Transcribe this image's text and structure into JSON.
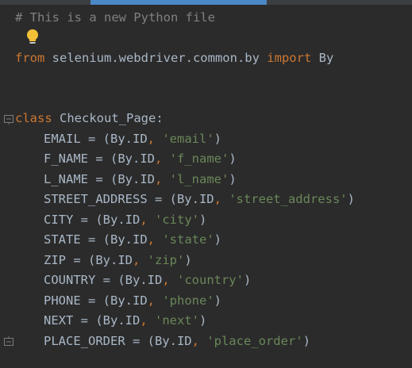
{
  "editor": {
    "comment": "# This is a new Python file",
    "import_line": {
      "from_kw": "from",
      "module": " selenium.webdriver.common.by ",
      "import_kw": "import",
      "name": " By"
    },
    "class_line": {
      "class_kw": "class",
      "name": " Checkout_Page:"
    },
    "fields": [
      {
        "name": "EMAIL = (By.ID",
        "comma": ",",
        "value": " 'email'",
        "close": ")"
      },
      {
        "name": "F_NAME = (By.ID",
        "comma": ",",
        "value": " 'f_name'",
        "close": ")"
      },
      {
        "name": "L_NAME = (By.ID",
        "comma": ",",
        "value": " 'l_name'",
        "close": ")"
      },
      {
        "name": "STREET_ADDRESS = (By.ID",
        "comma": ",",
        "value": " 'street_address'",
        "close": ")"
      },
      {
        "name": "CITY = (By.ID",
        "comma": ",",
        "value": " 'city'",
        "close": ")"
      },
      {
        "name": "STATE = (By.ID",
        "comma": ",",
        "value": " 'state'",
        "close": ")"
      },
      {
        "name": "ZIP = (By.ID",
        "comma": ",",
        "value": " 'zip'",
        "close": ")"
      },
      {
        "name": "COUNTRY = (By.ID",
        "comma": ",",
        "value": " 'country'",
        "close": ")"
      },
      {
        "name": "PHONE = (By.ID",
        "comma": ",",
        "value": " 'phone'",
        "close": ")"
      },
      {
        "name": "NEXT = (By.ID",
        "comma": ",",
        "value": " 'next'",
        "close": ")"
      },
      {
        "name": "PLACE_ORDER = (By.ID",
        "comma": ",",
        "value": " 'place_order'",
        "close": ")"
      }
    ],
    "icons": {
      "intention_bulb": "lightbulb-icon",
      "fold": "fold-marker-icon"
    },
    "colors": {
      "background": "#2b2b2b",
      "keyword": "#cc7832",
      "string": "#6a8759",
      "comment": "#808080",
      "text": "#a9b7c6",
      "bulb": "#f2c037",
      "scroll_thumb": "#4a88c7"
    }
  }
}
